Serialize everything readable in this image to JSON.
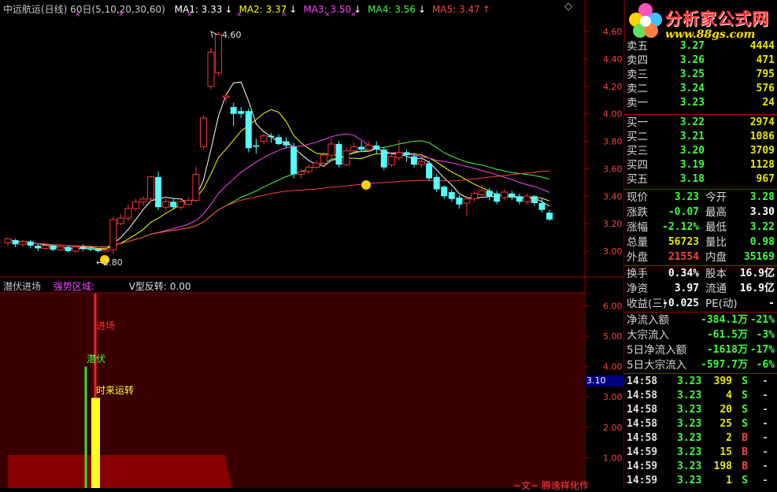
{
  "header": {
    "title": "中远航运(日线) 60日(5,10,20,30,60)",
    "ma": [
      {
        "label": "MA1: 3.33",
        "color": "#ffffff"
      },
      {
        "label": "MA2: 3.37",
        "color": "#ffff00"
      },
      {
        "label": "MA3: 3.50",
        "color": "#ff40ff"
      },
      {
        "label": "MA4: 3.56",
        "color": "#40ff40"
      },
      {
        "label": "MA5: 3.47",
        "color": "#ff4040"
      }
    ],
    "arrows": [
      "↓",
      "↓",
      "↓",
      "↓",
      "↑"
    ],
    "diamond": "◇"
  },
  "indicator": {
    "title": "潜伏进场",
    "strong_zone": "强势区域:",
    "v_reverse": "V型反转: 0.00",
    "labels": {
      "entry": "进场",
      "lurk": "潜伏",
      "turn": "时来运转"
    },
    "footer_text": "~文~ 腾逸祥化作",
    "cursor_value": "3.10"
  },
  "price_axis": {
    "ticks": [
      "4.60",
      "4.40",
      "4.20",
      "4.00",
      "3.80",
      "3.60",
      "3.40",
      "3.20",
      "3.00"
    ]
  },
  "ind_axis": {
    "ticks": [
      "6.00",
      "5.00",
      "4.00",
      "3.00",
      "2.00",
      "1.00"
    ]
  },
  "annotations": {
    "high": "4.60",
    "low": "2.80"
  },
  "logo": {
    "name": "分析家公式网",
    "url": "www.88gs.com"
  },
  "colors": {
    "up": "#ff3030",
    "down": "#54ffff",
    "green": "#40ff40",
    "bg_red": "#3a0000"
  },
  "quotes": {
    "sell": [
      {
        "label": "卖五",
        "price": "3.27",
        "vol": "4444"
      },
      {
        "label": "卖四",
        "price": "3.26",
        "vol": "471"
      },
      {
        "label": "卖三",
        "price": "3.25",
        "vol": "795"
      },
      {
        "label": "卖二",
        "price": "3.24",
        "vol": "576"
      },
      {
        "label": "卖一",
        "price": "3.23",
        "vol": "24"
      }
    ],
    "buy": [
      {
        "label": "买一",
        "price": "3.22",
        "vol": "2974"
      },
      {
        "label": "买二",
        "price": "3.21",
        "vol": "1086"
      },
      {
        "label": "买三",
        "price": "3.20",
        "vol": "3709"
      },
      {
        "label": "买四",
        "price": "3.19",
        "vol": "1128"
      },
      {
        "label": "买五",
        "price": "3.18",
        "vol": "967"
      }
    ]
  },
  "stats": [
    {
      "l1": "现价",
      "v1": "3.23",
      "c1": "#40ff40",
      "l2": "今开",
      "v2": "3.28",
      "c2": "#40ff40"
    },
    {
      "l1": "涨跌",
      "v1": "-0.07",
      "c1": "#40ff40",
      "l2": "最高",
      "v2": "3.30",
      "c2": "#ffffff"
    },
    {
      "l1": "涨幅",
      "v1": "-2.12%",
      "c1": "#40ff40",
      "l2": "最低",
      "v2": "3.22",
      "c2": "#40ff40"
    },
    {
      "l1": "总量",
      "v1": "56723",
      "c1": "#e8e800",
      "l2": "量比",
      "v2": "0.98",
      "c2": "#40ff40"
    },
    {
      "l1": "外盘",
      "v1": "21554",
      "c1": "#ff4040",
      "l2": "内盘",
      "v2": "35169",
      "c2": "#40ff40"
    }
  ],
  "stats2": [
    {
      "l1": "换手",
      "v1": "0.34%",
      "l2": "股本",
      "v2": "16.9亿"
    },
    {
      "l1": "净资",
      "v1": "3.97",
      "l2": "流通",
      "v2": "16.9亿"
    },
    {
      "l1": "收益(三)",
      "v1": "-0.025",
      "l2": "PE(动)",
      "v2": "-"
    }
  ],
  "flows": [
    {
      "label": "净流入额",
      "value": "-384.1万",
      "pct": "-21%"
    },
    {
      "label": "大宗流入",
      "value": "-61.5万",
      "pct": "-3%"
    },
    {
      "label": "5日净流入额",
      "value": "-1618万",
      "pct": "-17%"
    },
    {
      "label": "5日大宗流入",
      "value": "-597.7万",
      "pct": "-6%"
    }
  ],
  "ticks": [
    {
      "time": "14:58",
      "price": "3.23",
      "vol": "399",
      "side": "S"
    },
    {
      "time": "14:58",
      "price": "3.23",
      "vol": "4",
      "side": "S"
    },
    {
      "time": "14:58",
      "price": "3.23",
      "vol": "20",
      "side": "S"
    },
    {
      "time": "14:58",
      "price": "3.23",
      "vol": "25",
      "side": "S"
    },
    {
      "time": "14:58",
      "price": "3.23",
      "vol": "2",
      "side": "B"
    },
    {
      "time": "14:59",
      "price": "3.23",
      "vol": "15",
      "side": "B"
    },
    {
      "time": "14:59",
      "price": "3.23",
      "vol": "198",
      "side": "B"
    },
    {
      "time": "14:59",
      "price": "3.23",
      "vol": "1",
      "side": "S"
    }
  ],
  "candles": [
    {
      "o": 3.06,
      "c": 3.09,
      "h": 3.1,
      "l": 3.04
    },
    {
      "o": 3.08,
      "c": 3.05,
      "h": 3.09,
      "l": 3.03
    },
    {
      "o": 3.05,
      "c": 3.07,
      "h": 3.08,
      "l": 3.03
    },
    {
      "o": 3.07,
      "c": 3.04,
      "h": 3.08,
      "l": 3.02
    },
    {
      "o": 3.04,
      "c": 3.02,
      "h": 3.05,
      "l": 3.0
    },
    {
      "o": 3.02,
      "c": 3.04,
      "h": 3.05,
      "l": 3.01
    },
    {
      "o": 3.04,
      "c": 3.01,
      "h": 3.05,
      "l": 3.0
    },
    {
      "o": 3.01,
      "c": 3.03,
      "h": 3.04,
      "l": 3.0
    },
    {
      "o": 3.03,
      "c": 3.0,
      "h": 3.04,
      "l": 2.99
    },
    {
      "o": 3.0,
      "c": 3.03,
      "h": 3.04,
      "l": 2.99
    },
    {
      "o": 3.03,
      "c": 3.02,
      "h": 3.05,
      "l": 3.0
    },
    {
      "o": 3.02,
      "c": 3.01,
      "h": 3.04,
      "l": 3.0
    },
    {
      "o": 3.01,
      "c": 3.0,
      "h": 3.02,
      "l": 2.99
    },
    {
      "o": 3.0,
      "c": 3.01,
      "h": 3.03,
      "l": 2.99
    },
    {
      "o": 3.01,
      "c": 3.23,
      "h": 3.25,
      "l": 2.98
    },
    {
      "o": 3.2,
      "c": 3.24,
      "h": 3.27,
      "l": 3.19
    },
    {
      "o": 3.24,
      "c": 3.31,
      "h": 3.34,
      "l": 3.22
    },
    {
      "o": 3.31,
      "c": 3.36,
      "h": 3.38,
      "l": 3.29
    },
    {
      "o": 3.36,
      "c": 3.38,
      "h": 3.4,
      "l": 3.33
    },
    {
      "o": 3.38,
      "c": 3.54,
      "h": 3.55,
      "l": 3.36
    },
    {
      "o": 3.54,
      "c": 3.32,
      "h": 3.58,
      "l": 3.3
    },
    {
      "o": 3.32,
      "c": 3.36,
      "h": 3.38,
      "l": 3.3
    },
    {
      "o": 3.36,
      "c": 3.32,
      "h": 3.38,
      "l": 3.3
    },
    {
      "o": 3.32,
      "c": 3.36,
      "h": 3.37,
      "l": 3.3
    },
    {
      "o": 3.34,
      "c": 3.37,
      "h": 3.39,
      "l": 3.33
    },
    {
      "o": 3.37,
      "c": 3.56,
      "h": 3.62,
      "l": 3.36
    },
    {
      "o": 3.76,
      "c": 3.97,
      "h": 3.99,
      "l": 3.74
    },
    {
      "o": 4.2,
      "c": 4.45,
      "h": 4.48,
      "l": 4.18
    },
    {
      "o": 4.3,
      "c": 4.58,
      "h": 4.6,
      "l": 4.28
    },
    {
      "o": 4.12,
      "c": 4.13,
      "h": 4.15,
      "l": 4.08
    },
    {
      "o": 4.05,
      "c": 4.0,
      "h": 4.08,
      "l": 3.91
    },
    {
      "o": 4.02,
      "c": 4.0,
      "h": 4.05,
      "l": 3.97
    },
    {
      "o": 4.02,
      "c": 3.75,
      "h": 4.04,
      "l": 3.72
    },
    {
      "o": 3.77,
      "c": 3.76,
      "h": 3.82,
      "l": 3.71
    },
    {
      "o": 3.8,
      "c": 3.84,
      "h": 3.85,
      "l": 3.78
    },
    {
      "o": 3.84,
      "c": 3.83,
      "h": 3.86,
      "l": 3.79
    },
    {
      "o": 3.83,
      "c": 3.78,
      "h": 3.85,
      "l": 3.77
    },
    {
      "o": 3.8,
      "c": 3.77,
      "h": 3.83,
      "l": 3.75
    },
    {
      "o": 3.76,
      "c": 3.56,
      "h": 3.79,
      "l": 3.53
    },
    {
      "o": 3.56,
      "c": 3.58,
      "h": 3.6,
      "l": 3.53
    },
    {
      "o": 3.58,
      "c": 3.61,
      "h": 3.63,
      "l": 3.56
    },
    {
      "o": 3.61,
      "c": 3.64,
      "h": 3.66,
      "l": 3.6
    },
    {
      "o": 3.64,
      "c": 3.7,
      "h": 3.72,
      "l": 3.63
    },
    {
      "o": 3.7,
      "c": 3.78,
      "h": 3.82,
      "l": 3.66
    },
    {
      "o": 3.78,
      "c": 3.63,
      "h": 3.8,
      "l": 3.61
    },
    {
      "o": 3.63,
      "c": 3.73,
      "h": 3.75,
      "l": 3.62
    },
    {
      "o": 3.73,
      "c": 3.76,
      "h": 3.79,
      "l": 3.71
    },
    {
      "o": 3.76,
      "c": 3.74,
      "h": 3.8,
      "l": 3.72
    },
    {
      "o": 3.74,
      "c": 3.77,
      "h": 3.8,
      "l": 3.72
    },
    {
      "o": 3.77,
      "c": 3.74,
      "h": 3.8,
      "l": 3.71
    },
    {
      "o": 3.74,
      "c": 3.61,
      "h": 3.76,
      "l": 3.59
    },
    {
      "o": 3.63,
      "c": 3.69,
      "h": 3.71,
      "l": 3.61
    },
    {
      "o": 3.68,
      "c": 3.72,
      "h": 3.81,
      "l": 3.66
    },
    {
      "o": 3.72,
      "c": 3.7,
      "h": 3.74,
      "l": 3.65
    },
    {
      "o": 3.69,
      "c": 3.63,
      "h": 3.71,
      "l": 3.61
    },
    {
      "o": 3.63,
      "c": 3.65,
      "h": 3.67,
      "l": 3.61
    },
    {
      "o": 3.64,
      "c": 3.53,
      "h": 3.66,
      "l": 3.51
    },
    {
      "o": 3.54,
      "c": 3.45,
      "h": 3.56,
      "l": 3.43
    },
    {
      "o": 3.47,
      "c": 3.4,
      "h": 3.48,
      "l": 3.38
    },
    {
      "o": 3.43,
      "c": 3.38,
      "h": 3.45,
      "l": 3.36
    },
    {
      "o": 3.39,
      "c": 3.34,
      "h": 3.41,
      "l": 3.31
    },
    {
      "o": 3.35,
      "c": 3.38,
      "h": 3.4,
      "l": 3.26
    },
    {
      "o": 3.38,
      "c": 3.42,
      "h": 3.44,
      "l": 3.36
    },
    {
      "o": 3.41,
      "c": 3.44,
      "h": 3.48,
      "l": 3.4
    },
    {
      "o": 3.44,
      "c": 3.4,
      "h": 3.46,
      "l": 3.37
    },
    {
      "o": 3.42,
      "c": 3.36,
      "h": 3.44,
      "l": 3.34
    },
    {
      "o": 3.39,
      "c": 3.43,
      "h": 3.45,
      "l": 3.37
    },
    {
      "o": 3.42,
      "c": 3.39,
      "h": 3.44,
      "l": 3.37
    },
    {
      "o": 3.4,
      "c": 3.36,
      "h": 3.42,
      "l": 3.34
    },
    {
      "o": 3.36,
      "c": 3.4,
      "h": 3.42,
      "l": 3.34
    },
    {
      "o": 3.4,
      "c": 3.35,
      "h": 3.41,
      "l": 3.33
    },
    {
      "o": 3.35,
      "c": 3.3,
      "h": 3.38,
      "l": 3.28
    },
    {
      "o": 3.28,
      "c": 3.23,
      "h": 3.3,
      "l": 3.22
    }
  ]
}
